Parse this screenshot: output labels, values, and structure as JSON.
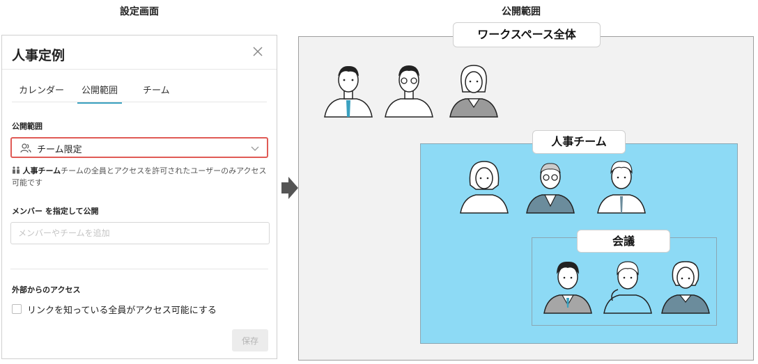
{
  "captions": {
    "left": "設定画面",
    "right": "公開範囲"
  },
  "panel": {
    "title": "人事定例",
    "tabs": [
      "カレンダー",
      "公開範囲",
      "チーム"
    ],
    "active_tab": "公開範囲",
    "scope_label": "公開範囲",
    "scope_value": "チーム限定",
    "help_bold": "人事チーム",
    "help_text": "チームの全員とアクセスを許可されたユーザーのみアクセス可能です",
    "member_label": "メンバー を指定して公開",
    "member_placeholder": "メンバーやチームを追加",
    "external_label": "外部からのアクセス",
    "checkbox_label": "リンクを知っている全員がアクセス可能にする",
    "save_label": "保存"
  },
  "diagram": {
    "workspace_label": "ワークスペース全体",
    "team_label": "人事チーム",
    "meeting_label": "会議"
  },
  "colors": {
    "accent": "#3aa1c0",
    "highlight_border": "#e05a55",
    "team_fill": "#8ddaf5",
    "workspace_fill": "#f2f2f2"
  }
}
